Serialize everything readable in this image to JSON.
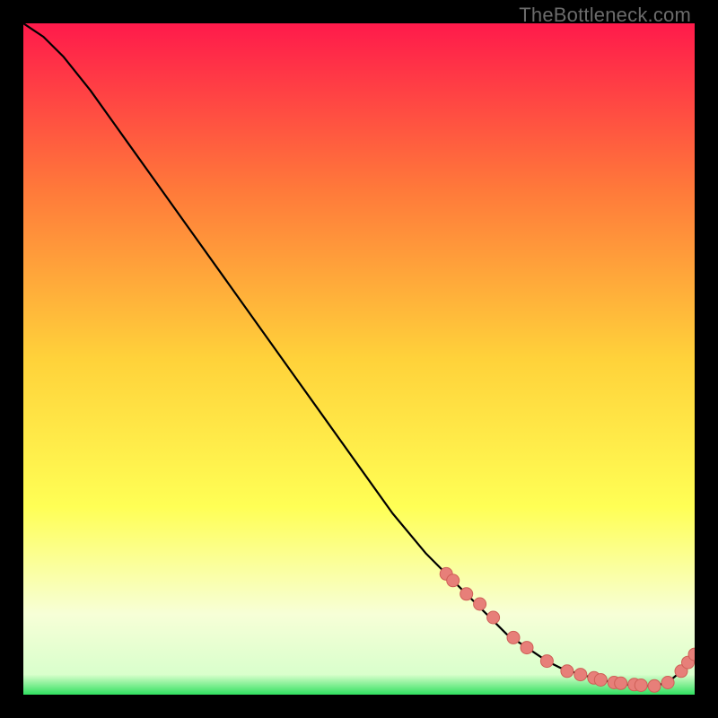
{
  "watermark": "TheBottleneck.com",
  "colors": {
    "gradient_top": "#ff1a4b",
    "gradient_mid1": "#ff7a3a",
    "gradient_mid2": "#ffd23a",
    "gradient_mid3": "#ffff55",
    "gradient_bottom_band": "#f7ffd7",
    "gradient_green": "#30e060",
    "curve": "#000000",
    "marker_fill": "#e77f79",
    "marker_stroke": "#cf5f57"
  },
  "chart_data": {
    "type": "line",
    "title": "",
    "xlabel": "",
    "ylabel": "",
    "xlim": [
      0,
      100
    ],
    "ylim": [
      0,
      100
    ],
    "series": [
      {
        "name": "bottleneck-curve",
        "x": [
          0,
          3,
          6,
          10,
          15,
          20,
          25,
          30,
          35,
          40,
          45,
          50,
          55,
          60,
          63,
          66,
          69,
          72,
          75,
          78,
          80,
          83,
          86,
          88,
          90,
          92,
          94,
          96,
          98,
          100
        ],
        "y": [
          100,
          98,
          95,
          90,
          83,
          76,
          69,
          62,
          55,
          48,
          41,
          34,
          27,
          21,
          18,
          15,
          12,
          9,
          7,
          5,
          4,
          3,
          2.2,
          1.8,
          1.5,
          1.3,
          1.3,
          1.8,
          3.5,
          6
        ]
      }
    ],
    "markers": {
      "name": "highlight-points",
      "x": [
        63,
        64,
        66,
        68,
        70,
        73,
        75,
        78,
        81,
        83,
        85,
        86,
        88,
        89,
        91,
        92,
        94,
        96,
        98,
        99,
        100
      ],
      "y": [
        18,
        17,
        15,
        13.5,
        11.5,
        8.5,
        7,
        5,
        3.5,
        3,
        2.5,
        2.2,
        1.8,
        1.7,
        1.5,
        1.4,
        1.3,
        1.8,
        3.5,
        4.8,
        6
      ]
    }
  }
}
